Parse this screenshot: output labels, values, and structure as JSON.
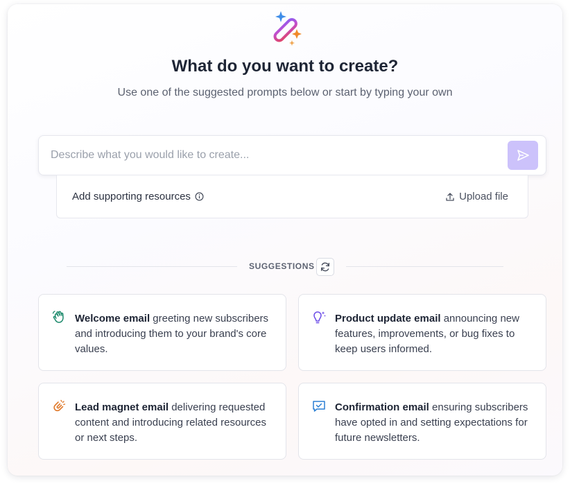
{
  "header": {
    "title": "What do you want to create?",
    "subtitle": "Use one of the suggested prompts below or start by typing your own"
  },
  "prompt": {
    "placeholder": "Describe what you would like to create...",
    "send_icon": "send-icon",
    "send_color": "#ccc2fb"
  },
  "resources": {
    "label": "Add supporting resources",
    "info_icon": "info-icon",
    "upload_label": "Upload file",
    "upload_icon": "upload-icon"
  },
  "suggestions": {
    "heading": "SUGGESTIONS",
    "refresh_icon": "refresh-icon",
    "items": [
      {
        "title": "Welcome email",
        "description": "greeting new subscribers and introducing them to your brand's core values.",
        "icon": "waving-hand-icon",
        "color": "#1d8a6c"
      },
      {
        "title": "Product update email",
        "description": "announcing new features, improvements, or bug fixes to keep users informed.",
        "icon": "lightbulb-icon",
        "color": "#6d4ee8"
      },
      {
        "title": "Lead magnet email",
        "description": "delivering requested content and introducing related resources or next steps.",
        "icon": "magnet-icon",
        "color": "#e07a2c"
      },
      {
        "title": "Confirmation email",
        "description": "ensuring subscribers have opted in and setting expectations for future newsletters.",
        "icon": "chat-check-icon",
        "color": "#2a7fd4"
      }
    ]
  }
}
